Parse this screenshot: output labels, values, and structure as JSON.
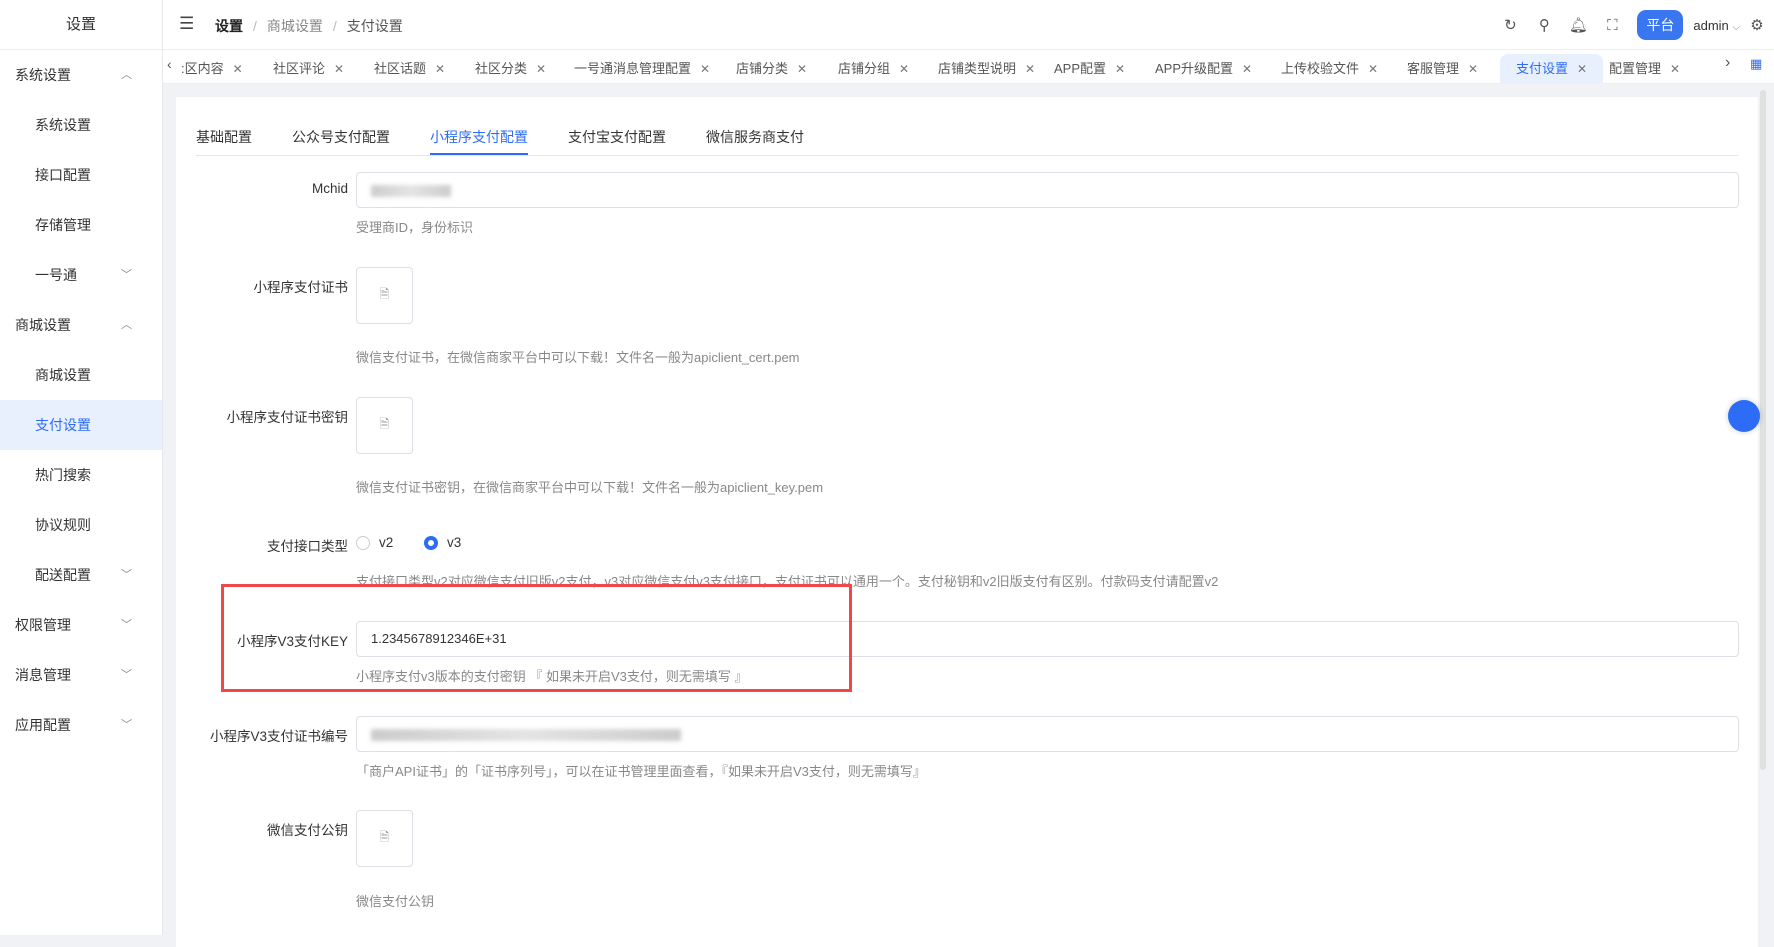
{
  "sidebar": {
    "title": "设置",
    "items": [
      {
        "label": "系统设置",
        "level": "top",
        "chev": "^"
      },
      {
        "label": "系统设置",
        "level": "sub"
      },
      {
        "label": "接口配置",
        "level": "sub"
      },
      {
        "label": "存储管理",
        "level": "sub"
      },
      {
        "label": "一号通",
        "level": "sub",
        "chev": "v"
      },
      {
        "label": "商城设置",
        "level": "top",
        "chev": "^"
      },
      {
        "label": "商城设置",
        "level": "sub"
      },
      {
        "label": "支付设置",
        "level": "sub",
        "active": true
      },
      {
        "label": "热门搜索",
        "level": "sub"
      },
      {
        "label": "协议规则",
        "level": "sub"
      },
      {
        "label": "配送配置",
        "level": "sub",
        "chev": "v"
      },
      {
        "label": "权限管理",
        "level": "top",
        "chev": "v"
      },
      {
        "label": "消息管理",
        "level": "top",
        "chev": "v"
      },
      {
        "label": "应用配置",
        "level": "top",
        "chev": "v"
      }
    ]
  },
  "header": {
    "breadcrumb": [
      "设置",
      "商城设置",
      "支付设置"
    ],
    "platform": "平台",
    "user": "admin"
  },
  "tabs": [
    ":区内容",
    "社区评论",
    "社区话题",
    "社区分类",
    "一号通消息管理配置",
    "店铺分类",
    "店铺分组",
    "店铺类型说明",
    "APP配置",
    "APP升级配置",
    "上传校验文件",
    "客服管理",
    "支付设置",
    "配置管理"
  ],
  "active_tab": "支付设置",
  "subtabs": [
    "基础配置",
    "公众号支付配置",
    "小程序支付配置",
    "支付宝支付配置",
    "微信服务商支付"
  ],
  "form": {
    "mchid": {
      "label": "Mchid",
      "hint": "受理商ID，身份标识"
    },
    "cert": {
      "label": "小程序支付证书",
      "hint": "微信支付证书，在微信商家平台中可以下载！文件名一般为apiclient_cert.pem"
    },
    "cert_key": {
      "label": "小程序支付证书密钥",
      "hint": "微信支付证书密钥，在微信商家平台中可以下载！文件名一般为apiclient_key.pem"
    },
    "api_type": {
      "label": "支付接口类型",
      "options": [
        "v2",
        "v3"
      ],
      "selected": "v3",
      "hint": "支付接口类型v2对应微信支付旧版v2支付，v3对应微信支付v3支付接口，支付证书可以通用一个。支付秘钥和v2旧版支付有区别。付款码支付请配置v2"
    },
    "v3_key": {
      "label": "小程序V3支付KEY",
      "value": "1.2345678912346E+31",
      "hint": "小程序支付v3版本的支付密钥 『 如果未开启V3支付，则无需填写 』"
    },
    "v3_serial": {
      "label": "小程序V3支付证书编号",
      "hint": "「商户API证书」的「证书序列号」，可以在证书管理里面查看，『如果未开启V3支付，则无需填写』"
    },
    "pubkey": {
      "label": "微信支付公钥",
      "hint": "微信支付公钥"
    }
  }
}
